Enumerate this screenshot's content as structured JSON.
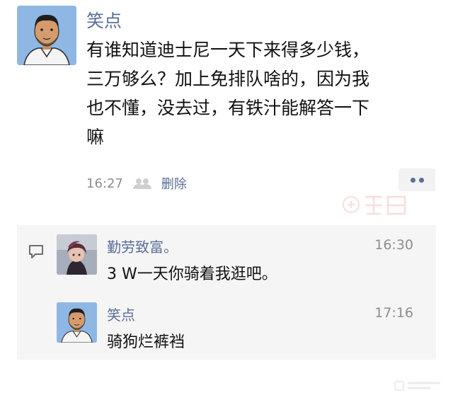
{
  "post": {
    "author": "笑点",
    "text": "有谁知道迪士尼一天下来得多少钱，\n三万够么？加上免排队啥的，因为我\n也不懂，没去过，有铁汁能解答一下\n嘛",
    "time": "16:27",
    "delete_label": "删除"
  },
  "comments": [
    {
      "author": "勤劳致富。",
      "time": "16:30",
      "text": "3 W一天你骑着我逛吧。"
    },
    {
      "author": "笑点",
      "time": "17:16",
      "text": "骑狗烂裤裆"
    }
  ],
  "icons": {
    "post_avatar": "man-avatar-icon",
    "likes": "people-icon",
    "more": "more-dots-icon",
    "comment": "comment-icon"
  },
  "colors": {
    "name_link": "#5a6e96",
    "muted": "#8d8d8d",
    "panel_bg": "#f5f5f5",
    "avatar_bg": "#8fb7e3"
  }
}
